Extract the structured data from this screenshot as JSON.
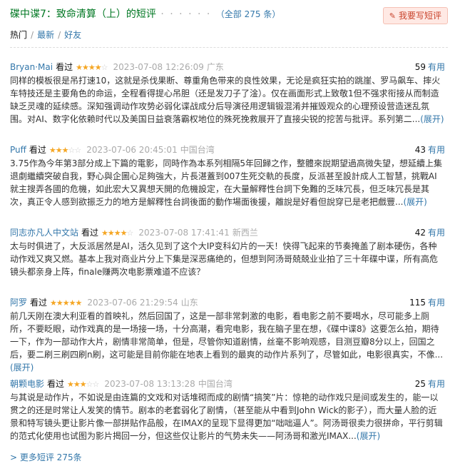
{
  "header": {
    "title": "碟中谍7：致命清算（上）的短评",
    "dots": "· · · · · ·",
    "count": "（全部 275 条）",
    "write_button": "我要写短评"
  },
  "sort": {
    "hot": "热门",
    "sep1": "/",
    "latest": "最新",
    "sep2": "/",
    "friends": "好友"
  },
  "reviews": [
    {
      "user": "Bryan·Mai",
      "status": "看过",
      "stars_on": "★★★★",
      "stars_off": "☆",
      "time": "2023-07-08 12:26:09",
      "location": "广东",
      "useful_count": "59",
      "useful_label": "有用",
      "text": "同样的模板很是吊打速10，这就是杀伐果断、尊重角色带来的良性效果，无论是疯狂实拍的跳崖、罗马飙车、摔火车特技还是主要角色的命运，全程看得提心吊胆（还是发刀子了淦）。仅在画面形式上致敬1但不强求衔接从而制造缺乏灵魂的延续感。深知强调动作攻势必弱化谍战成分后导演径用逻辑锻混淆并摧毁观众的心理预设营造迷乱氛围。对AI、数字化依赖时代以及美国日益衰落霸权地位的殊死挽救展开了直接尖锐的挖苦与批评。系列第二...",
      "expand": "(展开)"
    },
    {
      "user": "Puff",
      "status": "看过",
      "stars_on": "★★★",
      "stars_off": "☆☆",
      "time": "2023-07-06 20:45:01",
      "location": "中国台湾",
      "useful_count": "43",
      "useful_label": "有用",
      "text": "3.75作為今年第3部分成上下篇的電影，同時作為本系列相隔5年回歸之作，整體來說期望過高微失望，想延續上集退劇繼續突破自我，野心與企圖心足夠強大，片長湛蓋到007生死交軌的長度，反派甚至設計成人工智慧，挑戰AI就主搜弄各國的危機，如此宏大又異想天開的危機設定，在大量解釋性台詞下免難的乏味冗長，但乏味冗長是其次，真正令人感到欲振乏力的地方是解釋性台詞後面的動作場面後援，離說是好看但說穿已是老把戲豐...",
      "expand": "(展开)"
    },
    {
      "user": "同志亦凡人中文站",
      "status": "看过",
      "stars_on": "★★★★",
      "stars_off": "☆",
      "time": "2023-07-08 17:41:41",
      "location": "新西兰",
      "useful_count": "42",
      "useful_label": "有用",
      "text": "太与时俱进了，大反派居然是AI，活久见到了这个大IP变科幻片的一天！快得飞起来的节奏掩盖了剧本硬伤，各种动作戏又爽又燃。基本上我对商业片分上下集是深恶痛绝的，但想到阿汤哥兢兢业业拍了三十年碟中谍，所有高危镜头都亲身上阵，finale赚两次电影票难道不应该？",
      "expand": ""
    },
    {
      "user": "阿罗",
      "status": "看过",
      "stars_on": "★★★★★",
      "stars_off": "",
      "time": "2023-07-06 21:29:54",
      "location": "山东",
      "useful_count": "115",
      "useful_label": "有用",
      "text": "前几天刚在澳大利亚看的首映礼，然后回国了，这是一部非常刺激的电影，看电影之前不要喝水，尽可能多上厕所，不要眨眼，动作戏真的是一场接一场，十分高潮，看完电影，我在脑子里在想，《碟中谍8》这要怎么拍，期待一下，作为一部动作大片，剧情非常简单，但是，尽管你知道剧情，丝毫不影响观感，目测豆瓣8分以上，回国之后，要二刷三刷四刷n刷，这可能是目前你能在地表上看到的最爽的动作片系列了，尽管如此，电影很真实，不像...",
      "expand": "(展开)"
    },
    {
      "user": "朝颗电影",
      "status": "看过",
      "stars_on": "★★★",
      "stars_off": "☆☆",
      "time": "2023-07-08 13:13:28",
      "location": "中国台湾",
      "useful_count": "25",
      "useful_label": "有用",
      "text": "与其说是动作片，不如说是由连篇的文戏和对话堆砌而成的剧情“搞笑”片：惊艳的动作戏只是间或发生的，能一以贯之的还是时常让人发笑的情节。剧本的老套弱化了剧情，（甚至能从中看到John Wick的影子），而大量人脸的近景和特写镜头更让影片像一部拼贴作品般，在IMAX的呈现下显得更加“咄咄逼人”。阿汤哥很卖力很拼命，平行剪辑的范式化使用也试图为影片揭回一分，但这些仅让影片的气势未失——阿汤哥和激光IMAX...",
      "expand": "(展开)"
    }
  ],
  "more_link": "> 更多短评 275条"
}
